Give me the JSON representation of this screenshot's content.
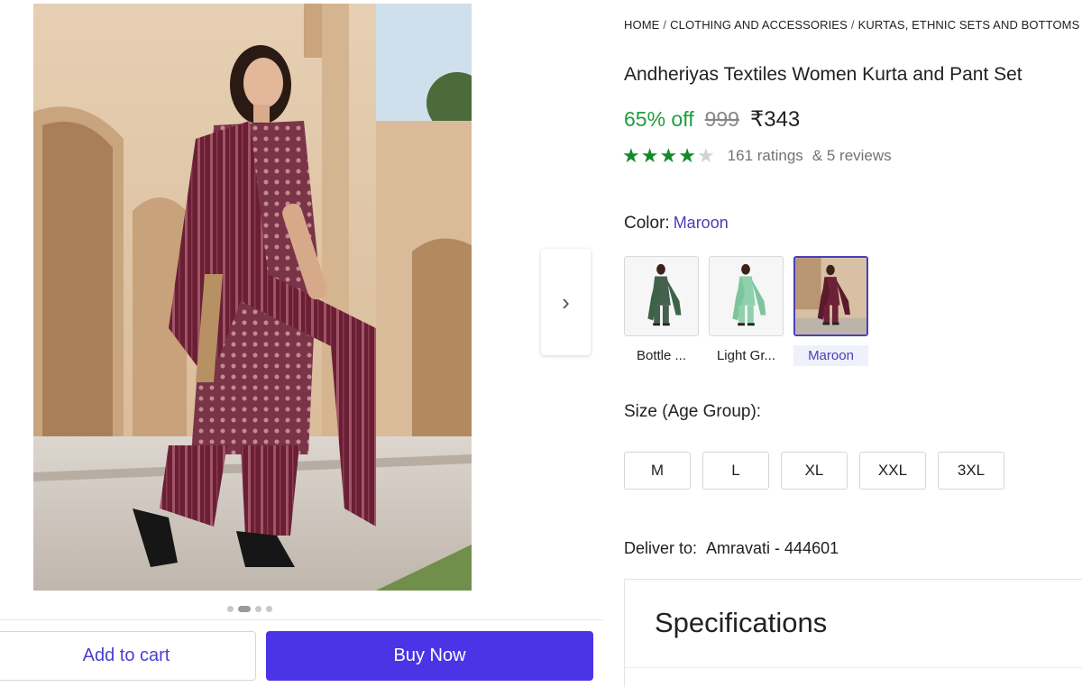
{
  "breadcrumb": [
    "HOME",
    "CLOTHING AND ACCESSORIES",
    "KURTAS, ETHNIC SETS AND BOTTOMS"
  ],
  "breadcrumb_separator": "/",
  "product": {
    "title": "Andheriyas Textiles Women Kurta and Pant Set",
    "discount": "65% off",
    "mrp": "999",
    "price": "₹343",
    "rating_stars": 4,
    "rating_max": 5,
    "ratings_text": "161 ratings",
    "reviews_text": "& 5 reviews"
  },
  "color": {
    "label": "Color:",
    "selected": "Maroon",
    "options": [
      {
        "label": "Bottle ...",
        "fabric": "#46604e",
        "dupatta": "#3d6347"
      },
      {
        "label": "Light Gr...",
        "fabric": "#8fd1ad",
        "dupatta": "#7cc59c"
      },
      {
        "label": "Maroon",
        "fabric": "#6e2136",
        "dupatta": "#5a1a2c"
      }
    ]
  },
  "size": {
    "label": "Size (Age Group):",
    "options": [
      "M",
      "L",
      "XL",
      "XXL",
      "3XL"
    ]
  },
  "delivery": {
    "label": "Deliver to:",
    "value": "Amravati - 444601"
  },
  "specifications": {
    "title": "Specifications"
  },
  "gallery": {
    "next_icon": "chevron-right-icon",
    "dot_count": 4,
    "active_dot": 1
  },
  "actions": {
    "add_to_cart": "Add to cart",
    "buy_now": "Buy Now"
  },
  "colors": {
    "accent": "#4b33e6",
    "link": "#4a3fb8",
    "discount": "#1e9e3c",
    "star": "#138a2a"
  }
}
